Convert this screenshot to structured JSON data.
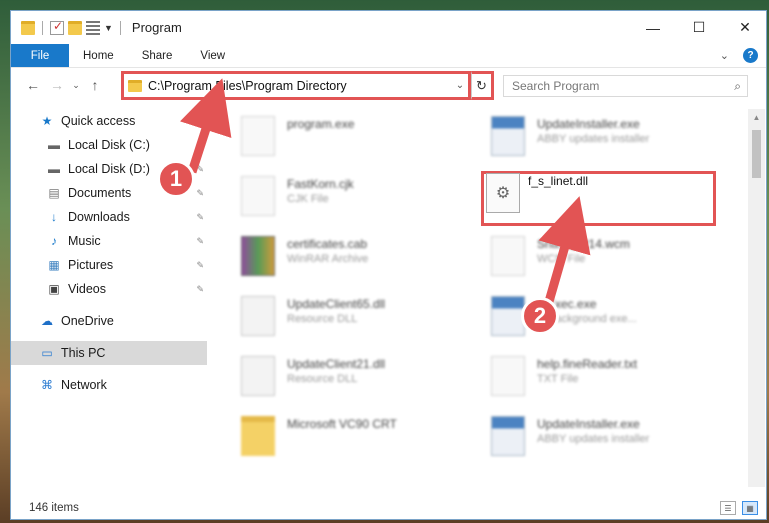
{
  "window": {
    "title": "Program",
    "controls": {
      "minimize": "—",
      "maximize": "☐",
      "close": "✕"
    }
  },
  "ribbon": {
    "tabs": [
      "File",
      "Home",
      "Share",
      "View"
    ],
    "expand_glyph": "⌄",
    "help_glyph": "?"
  },
  "nav": {
    "back": "←",
    "forward": "→",
    "recent": "⌄",
    "up": "↑",
    "address": "C:\\Program Files\\Program Directory",
    "address_chevron": "⌄",
    "refresh": "↻",
    "search_placeholder": "Search Program",
    "search_glyph": "⌕"
  },
  "sidebar": {
    "items": [
      {
        "label": "Quick access",
        "icon": "★",
        "icon_name": "star-icon",
        "pinned": false
      },
      {
        "label": "Local Disk (C:)",
        "icon": "▬",
        "icon_name": "drive-icon",
        "pinned": true
      },
      {
        "label": "Local Disk (D:)",
        "icon": "▬",
        "icon_name": "drive-icon",
        "pinned": true
      },
      {
        "label": "Documents",
        "icon": "▤",
        "icon_name": "documents-icon",
        "pinned": true
      },
      {
        "label": "Downloads",
        "icon": "↓",
        "icon_name": "downloads-icon",
        "pinned": true
      },
      {
        "label": "Music",
        "icon": "♪",
        "icon_name": "music-icon",
        "pinned": true
      },
      {
        "label": "Pictures",
        "icon": "▦",
        "icon_name": "pictures-icon",
        "pinned": true
      },
      {
        "label": "Videos",
        "icon": "▣",
        "icon_name": "videos-icon",
        "pinned": true
      },
      {
        "label": "OneDrive",
        "icon": "☁",
        "icon_name": "cloud-icon",
        "pinned": false
      },
      {
        "label": "This PC",
        "icon": "▭",
        "icon_name": "monitor-icon",
        "pinned": false
      },
      {
        "label": "Network",
        "icon": "⌘",
        "icon_name": "network-icon",
        "pinned": false
      }
    ],
    "pin_glyph": "✎"
  },
  "files": {
    "left": [
      {
        "name": "program.exe",
        "type": ""
      },
      {
        "name": "FastKorn.cjk",
        "type": "CJK File"
      },
      {
        "name": "certificates.cab",
        "type": "WinRAR Archive"
      },
      {
        "name": "UpdateClient65.dll",
        "type": "Resource DLL"
      },
      {
        "name": "UpdateClient21.dll",
        "type": "Resource DLL"
      },
      {
        "name": "Microsoft VC90 CRT",
        "type": ""
      }
    ],
    "right": [
      {
        "name": "UpdateInstaller.exe",
        "type": "ABBY updates installer"
      },
      {
        "name": "f_s_linet.dll",
        "type": ""
      },
      {
        "name": "Sna...@P14.wcm",
        "type": "WCM File"
      },
      {
        "name": "...Exec.exe",
        "type": "... background exe..."
      },
      {
        "name": "help.fineReader.txt",
        "type": "TXT File"
      },
      {
        "name": "UpdateInstaller.exe",
        "type": "ABBY updates installer"
      }
    ],
    "target_icon": "⚙"
  },
  "status": {
    "count": "146 items",
    "view_details": "☰",
    "view_icons": "▦"
  },
  "annotations": {
    "step1": "1",
    "step2": "2",
    "color": "#e25454"
  }
}
